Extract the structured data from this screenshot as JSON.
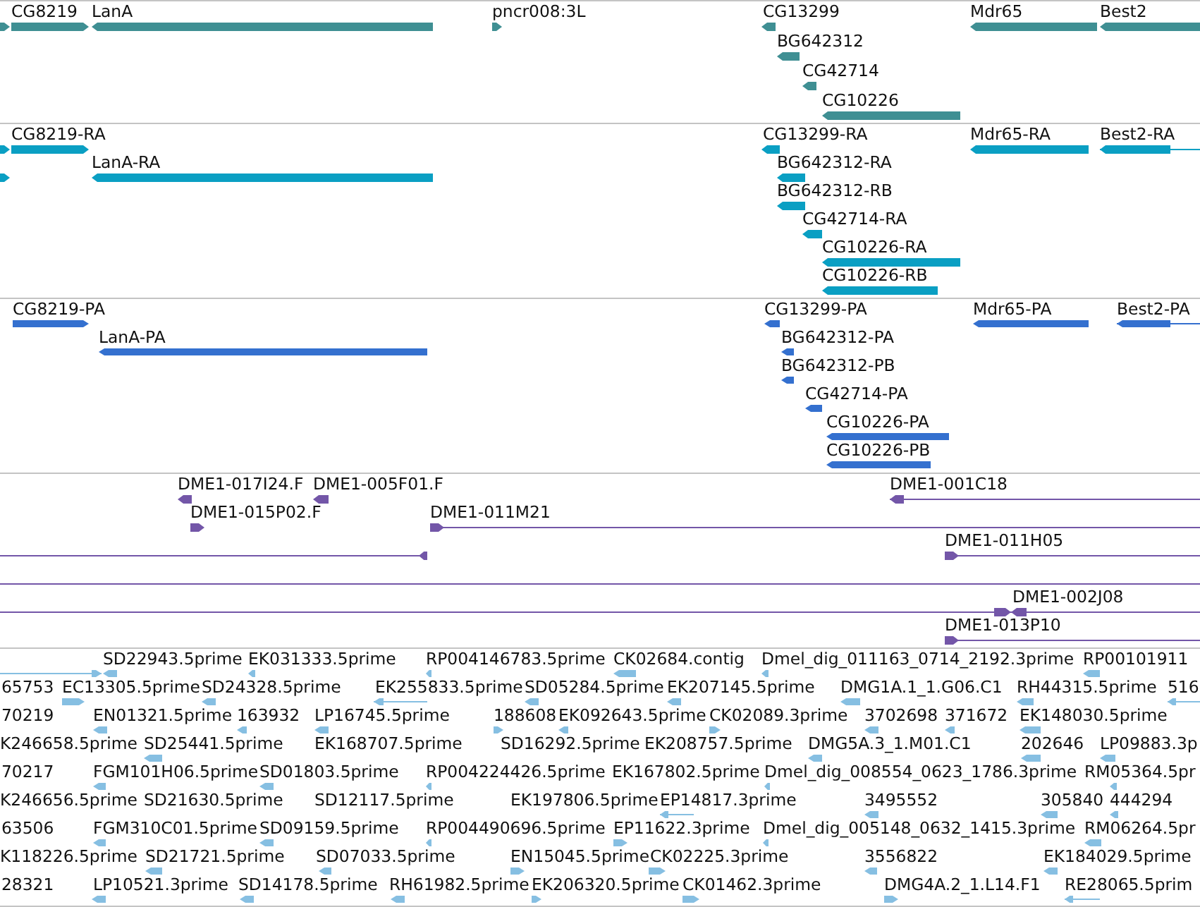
{
  "tracks": [
    {
      "kind": "gene",
      "features": [
        {
          "reverse": false
        },
        {
          "label": "CG8219",
          "reverse": false
        },
        {
          "label": "LanA",
          "reverse": true
        },
        {
          "label": "pncr008:3L",
          "reverse": false
        },
        {
          "label": "CG13299",
          "reverse": true
        },
        {
          "label": "Mdr65",
          "reverse": true
        },
        {
          "label": "Best2",
          "reverse": true
        },
        {
          "label": "BG642312",
          "reverse": true
        },
        {
          "label": "CG42714",
          "reverse": true
        },
        {
          "label": "CG10226",
          "reverse": true
        }
      ]
    },
    {
      "kind": "transcript",
      "features": [
        {
          "reverse": false
        },
        {
          "label": "CG8219-RA",
          "reverse": false
        },
        {
          "label": "CG13299-RA",
          "reverse": true
        },
        {
          "label": "Mdr65-RA",
          "reverse": true
        },
        {
          "label": "Best2-RA",
          "reverse": true
        },
        {
          "reverse": false
        },
        {
          "label": "LanA-RA",
          "reverse": true
        },
        {
          "label": "BG642312-RA",
          "reverse": true
        },
        {
          "label": "BG642312-RB",
          "reverse": true
        },
        {
          "label": "CG42714-RA",
          "reverse": true
        },
        {
          "label": "CG10226-RA",
          "reverse": true
        },
        {
          "label": "CG10226-RB",
          "reverse": true
        }
      ]
    },
    {
      "kind": "protein",
      "features": [
        {
          "label": "CG8219-PA",
          "reverse": false
        },
        {
          "label": "CG13299-PA",
          "reverse": true
        },
        {
          "label": "Mdr65-PA",
          "reverse": true
        },
        {
          "label": "Best2-PA",
          "reverse": true
        },
        {
          "label": "LanA-PA",
          "reverse": true
        },
        {
          "label": "BG642312-PA",
          "reverse": true
        },
        {
          "label": "BG642312-PB",
          "reverse": true
        },
        {
          "label": "CG42714-PA",
          "reverse": true
        },
        {
          "label": "CG10226-PA",
          "reverse": true
        },
        {
          "label": "CG10226-PB",
          "reverse": true
        }
      ]
    },
    {
      "kind": "clone",
      "features": [
        {
          "kind": "read",
          "label": "DME1-017I24.F",
          "reverse": true
        },
        {
          "kind": "read",
          "label": "DME1-005F01.F",
          "reverse": true
        },
        {
          "kind": "read",
          "label": "DME1-001C18",
          "reverse": true
        },
        {
          "kind": "read",
          "label": "DME1-015P02.F",
          "reverse": false
        },
        {
          "kind": "read",
          "label": "DME1-011M21",
          "reverse": false
        },
        {
          "kind": "read",
          "reverse": true
        },
        {
          "kind": "read",
          "label": "DME1-011H05",
          "reverse": false
        },
        {
          "kind": "line"
        },
        {
          "kind": "read",
          "reverse": false
        },
        {
          "kind": "read",
          "label": "DME1-002J08",
          "reverse": true
        },
        {
          "kind": "read",
          "label": "DME1-013P10",
          "reverse": false
        }
      ]
    },
    {
      "kind": "est",
      "features": [
        {
          "reverse": false
        },
        {
          "label": "SD22943.5prime",
          "reverse": true
        },
        {
          "label": "EK031333.5prime",
          "reverse": true
        },
        {
          "label": "RP004146783.5prime",
          "reverse": true
        },
        {
          "label": "CK02684.contig",
          "reverse": true
        },
        {
          "label": "Dmel_dig_011163_0714_2192.3prime",
          "reverse": true
        },
        {
          "label": "RP00101911",
          "reverse": true
        },
        {
          "label": "65753"
        },
        {
          "label": "EC13305.5prime",
          "reverse": false
        },
        {
          "label": "SD24328.5prime",
          "reverse": true
        },
        {
          "label": "EK255833.5prime",
          "reverse": true
        },
        {
          "label": "SD05284.5prime",
          "reverse": true
        },
        {
          "label": "EK207145.5prime",
          "reverse": true
        },
        {
          "label": "DMG1A.1_1.G06.C1",
          "reverse": true
        },
        {
          "label": "RH44315.5prime",
          "reverse": true
        },
        {
          "label": "516",
          "reverse": true
        },
        {
          "label": "70219"
        },
        {
          "label": "EN01321.5prime",
          "reverse": true
        },
        {
          "label": "163932",
          "reverse": true
        },
        {
          "label": "LP16745.5prime",
          "reverse": true
        },
        {
          "label": "188608",
          "reverse": false
        },
        {
          "label": "EK092643.5prime",
          "reverse": true
        },
        {
          "label": "CK02089.3prime",
          "reverse": false
        },
        {
          "label": "3702698",
          "reverse": true
        },
        {
          "label": "371672",
          "reverse": true
        },
        {
          "label": "EK148030.5prime",
          "reverse": true
        },
        {
          "label": "K246658.5prime"
        },
        {
          "label": "SD25441.5prime",
          "reverse": true
        },
        {
          "label": "EK168707.5prime"
        },
        {
          "label": "SD16292.5prime"
        },
        {
          "label": "EK208757.5prime"
        },
        {
          "label": "DMG5A.3_1.M01.C1",
          "reverse": true
        },
        {
          "label": "202646",
          "reverse": true
        },
        {
          "label": "LP09883.3p",
          "reverse": true
        },
        {
          "label": "70217"
        },
        {
          "label": "FGM101H06.5prime",
          "reverse": true
        },
        {
          "label": "SD01803.5prime",
          "reverse": true
        },
        {
          "label": "RP004224426.5prime",
          "reverse": true
        },
        {
          "label": "EK167802.5prime"
        },
        {
          "label": "Dmel_dig_008554_0623_1786.3prime",
          "reverse": true
        },
        {
          "label": "RM05364.5pr",
          "reverse": true
        },
        {
          "label": "K246656.5prime"
        },
        {
          "label": "SD21630.5prime"
        },
        {
          "label": "SD12117.5prime"
        },
        {
          "label": "EK197806.5prime"
        },
        {
          "label": "EP14817.3prime",
          "reverse": true
        },
        {
          "label": "3495552",
          "reverse": true
        },
        {
          "label": "305840",
          "reverse": true
        },
        {
          "label": "444294",
          "reverse": true
        },
        {
          "label": "63506"
        },
        {
          "label": "FGM310C01.5prime",
          "reverse": true
        },
        {
          "label": "SD09159.5prime",
          "reverse": true
        },
        {
          "label": "RP004490696.5prime",
          "reverse": true
        },
        {
          "label": "EP11622.3prime",
          "reverse": false
        },
        {
          "label": "Dmel_dig_005148_0632_1415.3prime",
          "reverse": true
        },
        {
          "label": "RM06264.5pr",
          "reverse": true
        },
        {
          "label": "K118226.5prime"
        },
        {
          "label": "SD21721.5prime",
          "reverse": true
        },
        {
          "label": "SD07033.5prime",
          "reverse": true
        },
        {
          "label": "EN15045.5prime",
          "reverse": false
        },
        {
          "label": "CK02225.3prime",
          "reverse": false
        },
        {
          "label": "3556822",
          "reverse": true
        },
        {
          "label": "EK184029.5prime",
          "reverse": true
        },
        {
          "label": "28321"
        },
        {
          "label": "LP10521.3prime",
          "reverse": true
        },
        {
          "label": "SD14178.5prime",
          "reverse": true
        },
        {
          "label": "RH61982.5prime",
          "reverse": true
        },
        {
          "label": "EK206320.5prime",
          "reverse": false
        },
        {
          "label": "CK01462.3prime",
          "reverse": false
        },
        {
          "label": "DMG4A.2_1.L14.F1",
          "reverse": false
        },
        {
          "label": "RE28065.5prim",
          "reverse": true
        }
      ]
    }
  ]
}
